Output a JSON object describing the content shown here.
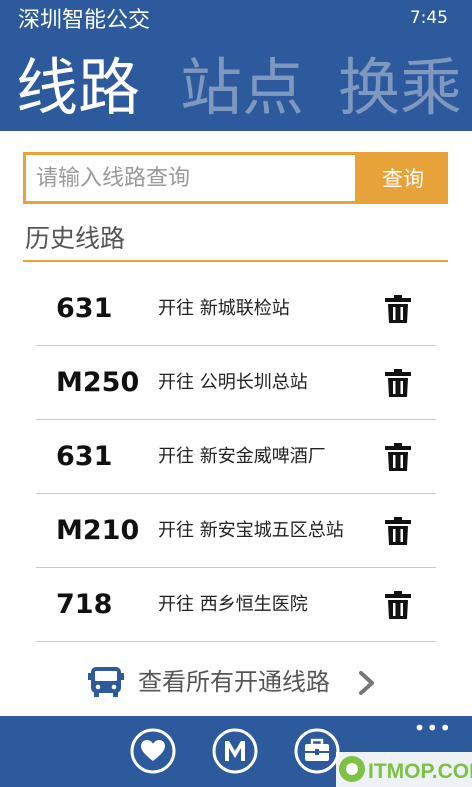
{
  "status": {
    "app_title": "深圳智能公交",
    "time": "7:45"
  },
  "pivot": {
    "items": [
      "线路",
      "站点",
      "换乘"
    ],
    "active_index": 0
  },
  "search": {
    "placeholder": "请输入线路查询",
    "value": "",
    "button_label": "查询"
  },
  "history": {
    "title": "历史线路",
    "rows": [
      {
        "route": "631",
        "destination": "开往 新城联检站"
      },
      {
        "route": "M250",
        "destination": "开往 公明长圳总站"
      },
      {
        "route": "631",
        "destination": "开往 新安金威啤酒厂"
      },
      {
        "route": "M210",
        "destination": "开往 新安宝城五区总站"
      },
      {
        "route": "718",
        "destination": "开往 西乡恒生医院"
      }
    ]
  },
  "view_all": {
    "label": "查看所有开通线路"
  },
  "appbar": {
    "more": "•••",
    "buttons": [
      "favorite-icon",
      "metro-icon",
      "briefcase-icon"
    ]
  },
  "watermark": {
    "text": "ITMOP.COM"
  },
  "colors": {
    "primary": "#2c5a9c",
    "accent": "#e8a23a",
    "watermark": "#7dc242"
  }
}
